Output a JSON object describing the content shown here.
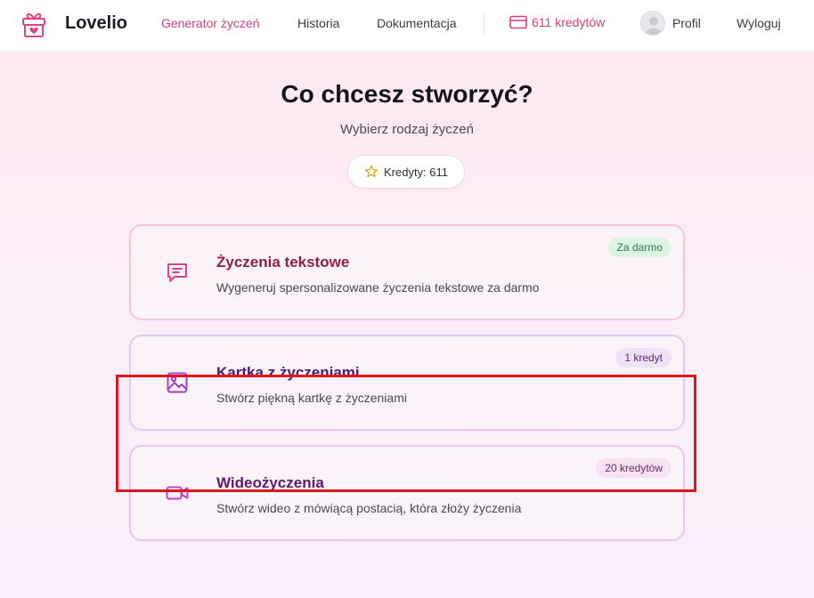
{
  "header": {
    "brand": "Lovelio",
    "nav": {
      "generator": "Generator życzeń",
      "history": "Historia",
      "docs": "Dokumentacja"
    },
    "credits_label": "611 kredytów",
    "profile": "Profil",
    "logout": "Wyloguj"
  },
  "main": {
    "title": "Co chcesz stworzyć?",
    "subtitle": "Wybierz rodzaj życzeń",
    "credits_pill": "Kredyty: 611",
    "cards": [
      {
        "title": "Życzenia tekstowe",
        "description": "Wygeneruj spersonalizowane życzenia tekstowe za darmo",
        "badge": "Za darmo",
        "icon": "message-square-icon"
      },
      {
        "title": "Kartka z życzeniami",
        "description": "Stwórz piękną kartkę z życzeniami",
        "badge": "1 kredyt",
        "icon": "image-icon"
      },
      {
        "title": "Wideożyczenia",
        "description": "Stwórz wideo z mówiącą postacią, która złoży życzenia",
        "badge": "20 kredytów",
        "icon": "video-icon"
      }
    ]
  },
  "colors": {
    "accent": "#d63b7a",
    "highlight": "#e0161c",
    "free_badge_bg": "#dcf5e3"
  }
}
